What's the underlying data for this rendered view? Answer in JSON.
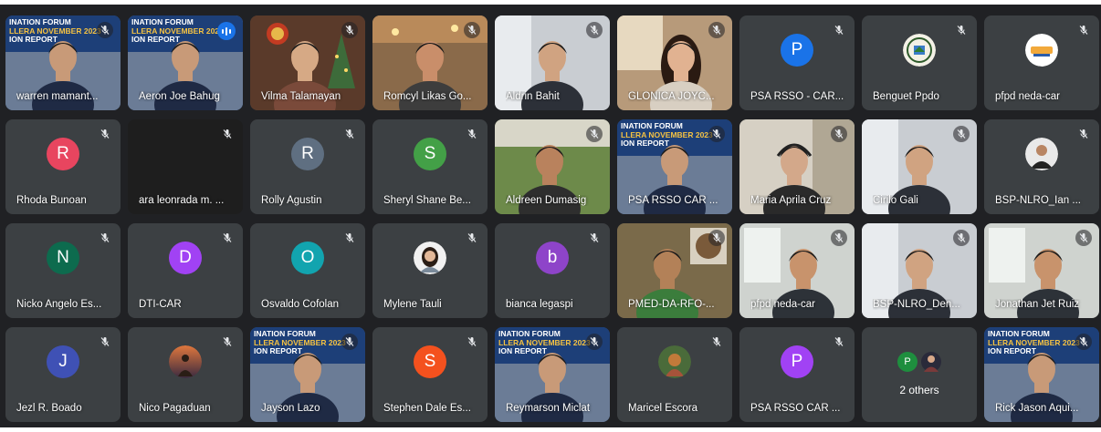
{
  "meeting": {
    "tiles": [
      {
        "name": "warren mamant...",
        "type": "video",
        "scene": "banner-man",
        "muted": true
      },
      {
        "name": "Aeron Joe Bahug",
        "type": "video",
        "scene": "banner-man",
        "muted": false,
        "speaking": true
      },
      {
        "name": "Vilma Talamayan",
        "type": "video",
        "scene": "xmas",
        "muted": true
      },
      {
        "name": "Romcyl Likas Go...",
        "type": "video",
        "scene": "warm-room",
        "muted": true
      },
      {
        "name": "Aldrin Bahit",
        "type": "video",
        "scene": "office-man",
        "muted": true
      },
      {
        "name": "GLONICA JOYC...",
        "type": "video",
        "scene": "girl",
        "muted": true
      },
      {
        "name": "PSA RSSO - CAR...",
        "type": "avatar",
        "initial": "P",
        "color": "#1a73e8",
        "muted": true
      },
      {
        "name": "Benguet Ppdo",
        "type": "photo-avatar",
        "scene": "seal",
        "muted": true
      },
      {
        "name": "pfpd neda-car",
        "type": "photo-avatar",
        "scene": "logo",
        "muted": true
      },
      {
        "name": "Rhoda Bunoan",
        "type": "avatar",
        "initial": "R",
        "color": "#e8455f",
        "muted": true
      },
      {
        "name": "ara leonrada m. ...",
        "type": "dark",
        "muted": true
      },
      {
        "name": "Rolly Agustin",
        "type": "avatar",
        "initial": "R",
        "color": "#5f6f81",
        "muted": true
      },
      {
        "name": "Sheryl Shane Be...",
        "type": "avatar",
        "initial": "S",
        "color": "#43a047",
        "muted": true
      },
      {
        "name": "Aldreen Dumasig",
        "type": "video",
        "scene": "green-wall",
        "muted": true
      },
      {
        "name": "PSA RSSO CAR ...",
        "type": "video",
        "scene": "banner-man",
        "muted": true
      },
      {
        "name": "Maria Aprila Cruz",
        "type": "video",
        "scene": "woman-headset",
        "muted": true
      },
      {
        "name": "Cirilo Gali",
        "type": "video",
        "scene": "office-man",
        "muted": true
      },
      {
        "name": "BSP-NLRO_Ian ...",
        "type": "photo-avatar",
        "scene": "person",
        "muted": true
      },
      {
        "name": "Nicko Angelo Es...",
        "type": "avatar",
        "initial": "N",
        "color": "#0d6b4e",
        "muted": true
      },
      {
        "name": "DTI-CAR",
        "type": "avatar",
        "initial": "D",
        "color": "#a142f4",
        "muted": true
      },
      {
        "name": "Osvaldo Cofolan",
        "type": "avatar",
        "initial": "O",
        "color": "#12a4af",
        "muted": true
      },
      {
        "name": "Mylene Tauli",
        "type": "photo-avatar",
        "scene": "person-light",
        "muted": true
      },
      {
        "name": "bianca legaspi",
        "type": "avatar",
        "initial": "b",
        "color": "#8e44c9",
        "muted": true
      },
      {
        "name": "PMED-DA-RFO-...",
        "type": "video",
        "scene": "green-office",
        "muted": true
      },
      {
        "name": "pfpd neda-car",
        "type": "video",
        "scene": "window-man",
        "muted": true
      },
      {
        "name": "BSP-NLRO_Den...",
        "type": "video",
        "scene": "office-man",
        "muted": true
      },
      {
        "name": "Jonathan Jet Ruiz",
        "type": "video",
        "scene": "window-man",
        "muted": true
      },
      {
        "name": "Jezl R. Boado",
        "type": "avatar",
        "initial": "J",
        "color": "#3f51b5",
        "muted": true
      },
      {
        "name": "Nico Pagaduan",
        "type": "photo-avatar",
        "scene": "sunset",
        "muted": true
      },
      {
        "name": "Jayson Lazo",
        "type": "video",
        "scene": "banner-man",
        "muted": true
      },
      {
        "name": "Stephen Dale Es...",
        "type": "avatar",
        "initial": "S",
        "color": "#f4511e",
        "muted": true
      },
      {
        "name": "Reymarson Miclat",
        "type": "video",
        "scene": "banner-man",
        "muted": true
      },
      {
        "name": "Maricel Escora",
        "type": "photo-avatar",
        "scene": "forest",
        "muted": true
      },
      {
        "name": "PSA RSSO CAR ...",
        "type": "avatar",
        "initial": "P",
        "color": "#a142f4",
        "muted": true
      },
      {
        "name": "2 others",
        "type": "others",
        "initial": "P",
        "color": "#1e8e3e",
        "muted": false
      },
      {
        "name": "Rick Jason Aqui...",
        "type": "video",
        "scene": "banner-man",
        "muted": true
      }
    ],
    "banner_line1": "INATION FORUM",
    "banner_line2": "LLERA NOVEMBER 2023",
    "banner_line3": "ION REPORT"
  }
}
